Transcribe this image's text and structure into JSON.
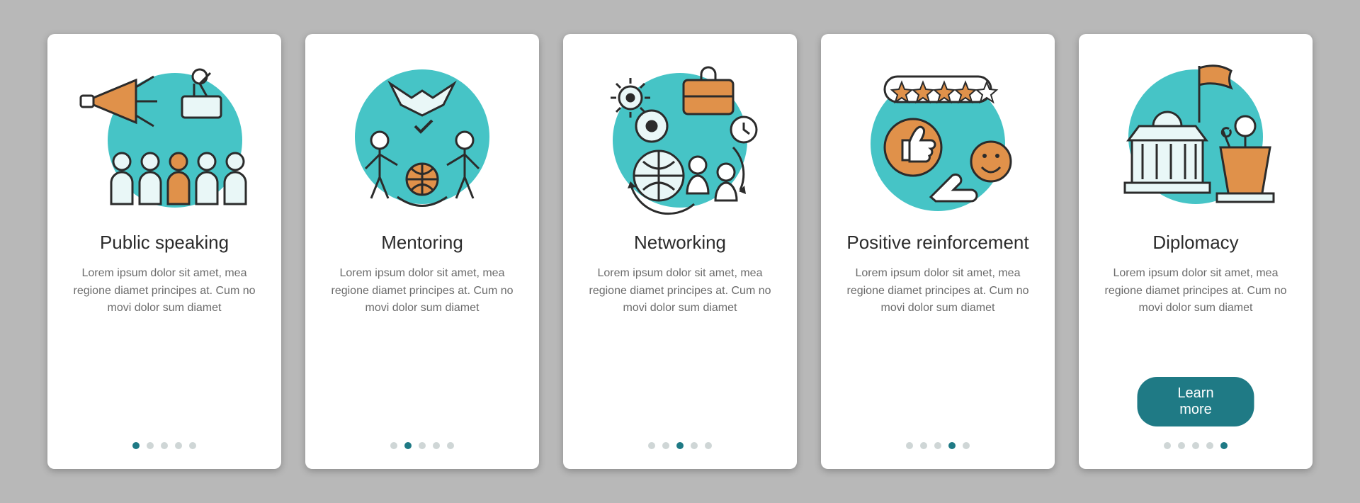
{
  "colors": {
    "teal": "#46c4c6",
    "dark_teal": "#1f7a85",
    "orange": "#e0914a",
    "stroke": "#2b2b2b",
    "light": "#e9f7f7",
    "text": "#6b6b6b"
  },
  "lorem": "Lorem ipsum dolor sit amet, mea regione diamet principes at. Cum no movi dolor sum diamet",
  "cards": [
    {
      "id": "public-speaking",
      "title": "Public speaking",
      "icon": "megaphone-crowd-icon",
      "active_dot": 0
    },
    {
      "id": "mentoring",
      "title": "Mentoring",
      "icon": "handshake-people-icon",
      "active_dot": 1
    },
    {
      "id": "networking",
      "title": "Networking",
      "icon": "globe-gears-briefcase-icon",
      "active_dot": 2
    },
    {
      "id": "positive-reinforcement",
      "title": "Positive reinforcement",
      "icon": "stars-thumbsup-smiley-icon",
      "active_dot": 3
    },
    {
      "id": "diplomacy",
      "title": "Diplomacy",
      "icon": "government-podium-flag-icon",
      "active_dot": 4,
      "cta": "Learn more"
    }
  ],
  "dot_count": 5
}
